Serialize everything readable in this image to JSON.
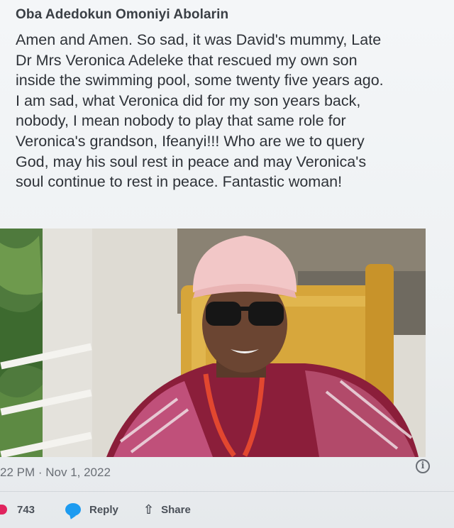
{
  "post": {
    "author": "Oba Adedokun Omoniyi Abolarin",
    "text_lines": [
      "Amen and Amen. So sad, it was David's mummy, Late",
      "Dr Mrs Veronica Adeleke that rescued my own son",
      "inside the swimming pool, some twenty five years ago.",
      "I am sad, what Veronica did for my son years back,",
      "nobody, I mean nobody to play that same role for",
      "Veronica's grandson, Ifeanyi!!! Who are we to query",
      "God, may his soul  rest in peace and may Veronica's",
      "soul continue to rest in peace. Fantastic woman!"
    ],
    "timestamp": "22 PM · Nov 1, 2022",
    "info_symbol": "i"
  },
  "actions": {
    "like_count": "743",
    "like_icon": "heart-icon",
    "reply_label": "Reply",
    "reply_icon": "speech-bubble-icon",
    "share_label": "Share",
    "share_icon": "share-arrow-icon",
    "share_glyph": "⇧"
  },
  "colors": {
    "like": "#e0245e",
    "reply": "#1d9bf0",
    "text": "#2e3238",
    "muted": "#6a6f76"
  }
}
